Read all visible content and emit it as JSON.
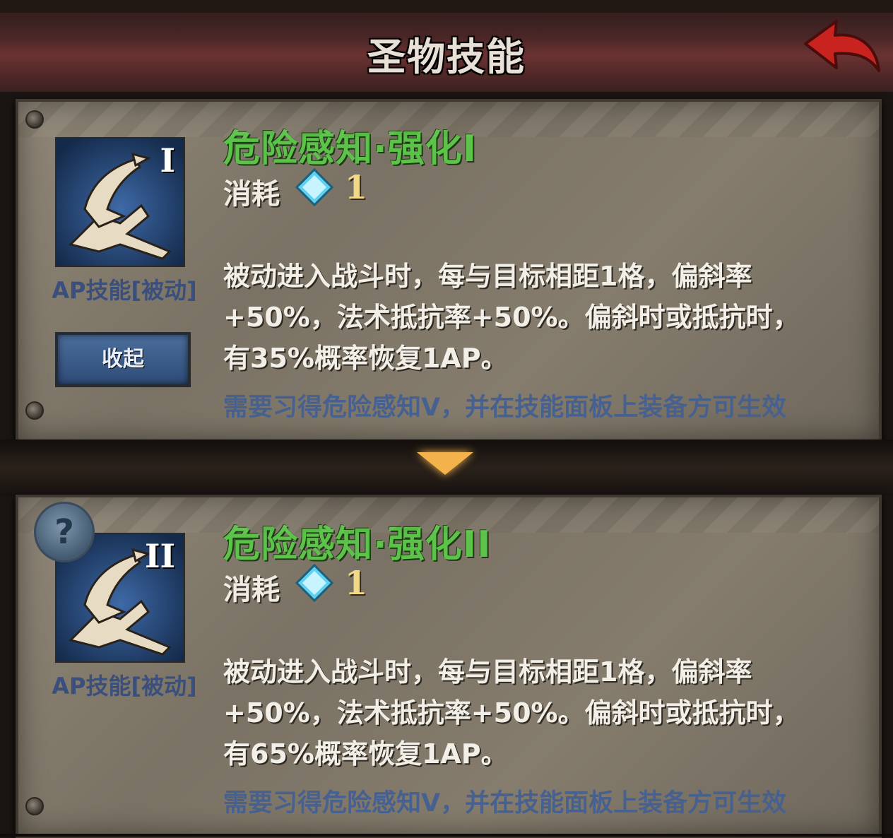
{
  "header": {
    "title": "圣物技能"
  },
  "cards": [
    {
      "numeral": "I",
      "skill_type": "AP技能[被动]",
      "name": "危险感知·强化I",
      "cost_label": "消耗",
      "cost_value": "1",
      "description_lines": [
        "被动进入战斗时，每与目标相距1格，偏斜率",
        "+50%，法术抵抗率+50%。偏斜时或抵抗时，",
        "有35%概率恢复1AP。"
      ],
      "requirement": "需要习得危险感知V，并在技能面板上装备方可生效",
      "collapse_label": "收起"
    },
    {
      "numeral": "II",
      "skill_type": "AP技能[被动]",
      "name": "危险感知·强化II",
      "cost_label": "消耗",
      "cost_value": "1",
      "description_lines": [
        "被动进入战斗时，每与目标相距1格，偏斜率",
        "+50%，法术抵抗率+50%。偏斜时或抵抗时，",
        "有65%概率恢复1AP。"
      ],
      "requirement": "需要习得危险感知V，并在技能面板上装备方可生效",
      "help_icon": "?"
    }
  ],
  "colors": {
    "skill_name": "#5cc24a",
    "requirement": "#46608f",
    "skill_type": "#3a4f7c",
    "cost_value": "#f2d98a"
  }
}
